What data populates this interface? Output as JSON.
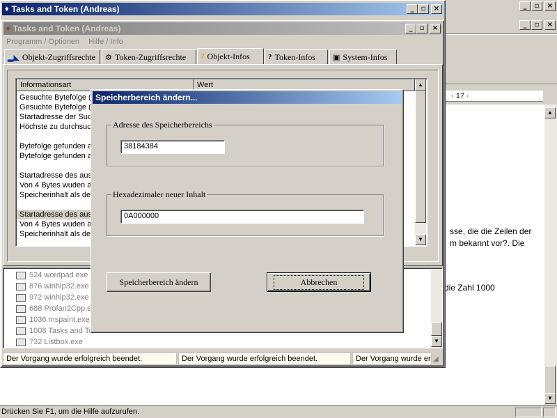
{
  "outer_window": {
    "title": "Tasks and Token  (Andreas)"
  },
  "inner_window": {
    "title": "Tasks and Token  (Andreas)",
    "menu": [
      "Programm / Optionen",
      "Hilfe / Info"
    ],
    "tabs": [
      {
        "label": "Objekt-Zugriffsrechte",
        "icon": "user-key-icon"
      },
      {
        "label": "Token-Zugriffsrechte",
        "icon": "users-gear-icon"
      },
      {
        "label": "Objekt-Infos",
        "icon": "question-bulb-icon"
      },
      {
        "label": "Token-Infos",
        "icon": "question-user-icon"
      },
      {
        "label": "System-Infos",
        "icon": "computer-icon"
      }
    ],
    "active_tab": "Objekt-Infos",
    "list_headers": [
      "Informationsart",
      "Wert"
    ],
    "list_rows": [
      "Gesuchte Bytefolge (a",
      "Gesuchte Bytefolge (a",
      "Startadresse der Suc",
      "Höchste zu durchsuch",
      "",
      "Bytefolge gefunden a",
      "Bytefolge gefunden a",
      "",
      "Startadresse des aus",
      "Von 4 Bytes wuden au",
      "Speicherinhalt als dez",
      "",
      "Startadresse des aus",
      "Von 4 Bytes wuden au",
      "Speicherinhalt als dez"
    ],
    "processes": [
      "524 wordpad.exe",
      "876 winhlp32.exe",
      "972 winhlp32.exe",
      "688 Profan2Cpp.e",
      "1036 mspaint.exe",
      "1008 Tasks and To",
      "732 Listbox.exe"
    ],
    "status": [
      "Der Vorgang wurde erfolgreich beendet.",
      "Der Vorgang wurde erfolgreich beendet.",
      "Der Vorgang wurde erfo"
    ]
  },
  "dialog": {
    "title": "Speicherbereich ändern...",
    "group1_label": "Adresse des Speicherbereichs",
    "address_value": "38184384",
    "group2_label": "Hexadezimaler neuer Inhalt",
    "content_value": "0A000000",
    "apply_button": "Speicherbereich ändern",
    "cancel_button": "Abbrechen"
  },
  "background_app": {
    "ruler_text": "· 17 ·",
    "doc_line1": "sse, die die Zeilen der",
    "doc_line2": "m bekannt vor?. Die",
    "doc_line3": "die Zahl 1000",
    "statusbar": "Drücken Sie F1, um die Hilfe aufzurufen."
  },
  "colors": {
    "titlebar_active": "#0a246a",
    "titlebar_gradient_end": "#a6caf0",
    "face": "#d4d0c8"
  }
}
